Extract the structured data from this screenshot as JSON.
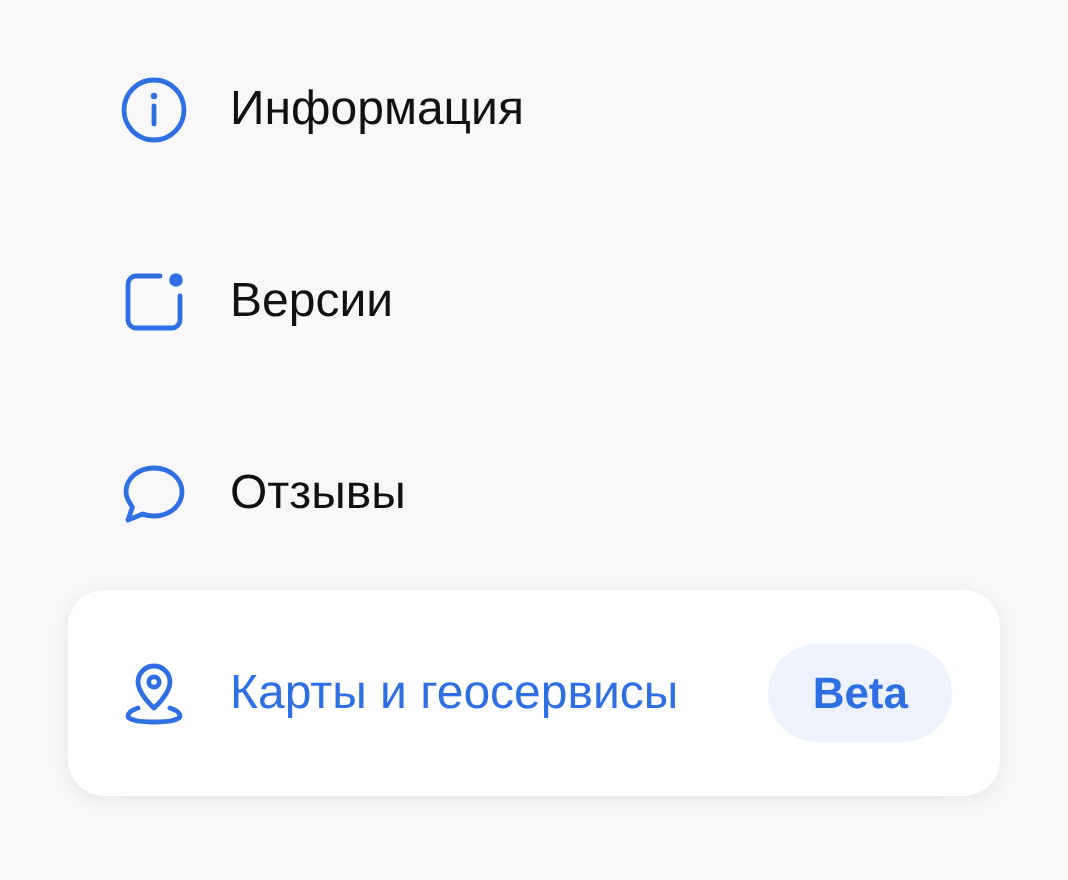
{
  "menu": {
    "items": [
      {
        "kind": "info",
        "label": "Информация",
        "selected": false
      },
      {
        "kind": "versions",
        "label": "Версии",
        "selected": false
      },
      {
        "kind": "feedback",
        "label": "Отзывы",
        "selected": false
      },
      {
        "kind": "map",
        "label": "Карты и геосервисы",
        "selected": true,
        "badge": "Beta"
      }
    ]
  }
}
